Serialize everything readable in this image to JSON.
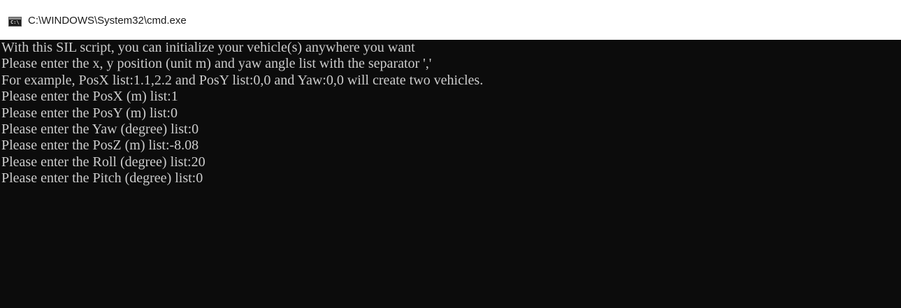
{
  "window": {
    "title": "C:\\WINDOWS\\System32\\cmd.exe",
    "icon": "console-icon"
  },
  "console": {
    "lines": [
      "With this SIL script, you can initialize your vehicle(s) anywhere you want",
      "Please enter the x, y position (unit m) and yaw angle list with the separator ','",
      "For example, PosX list:1.1,2.2 and PosY list:0,0 and Yaw:0,0 will create two vehicles.",
      "Please enter the PosX (m) list:1",
      "Please enter the PosY (m) list:0",
      "Please enter the Yaw (degree) list:0",
      "Please enter the PosZ (m) list:-8.08",
      "Please enter the Roll (degree) list:20",
      "Please enter the Pitch (degree) list:0"
    ],
    "background": "#0c0c0c",
    "foreground": "#cccccc"
  }
}
